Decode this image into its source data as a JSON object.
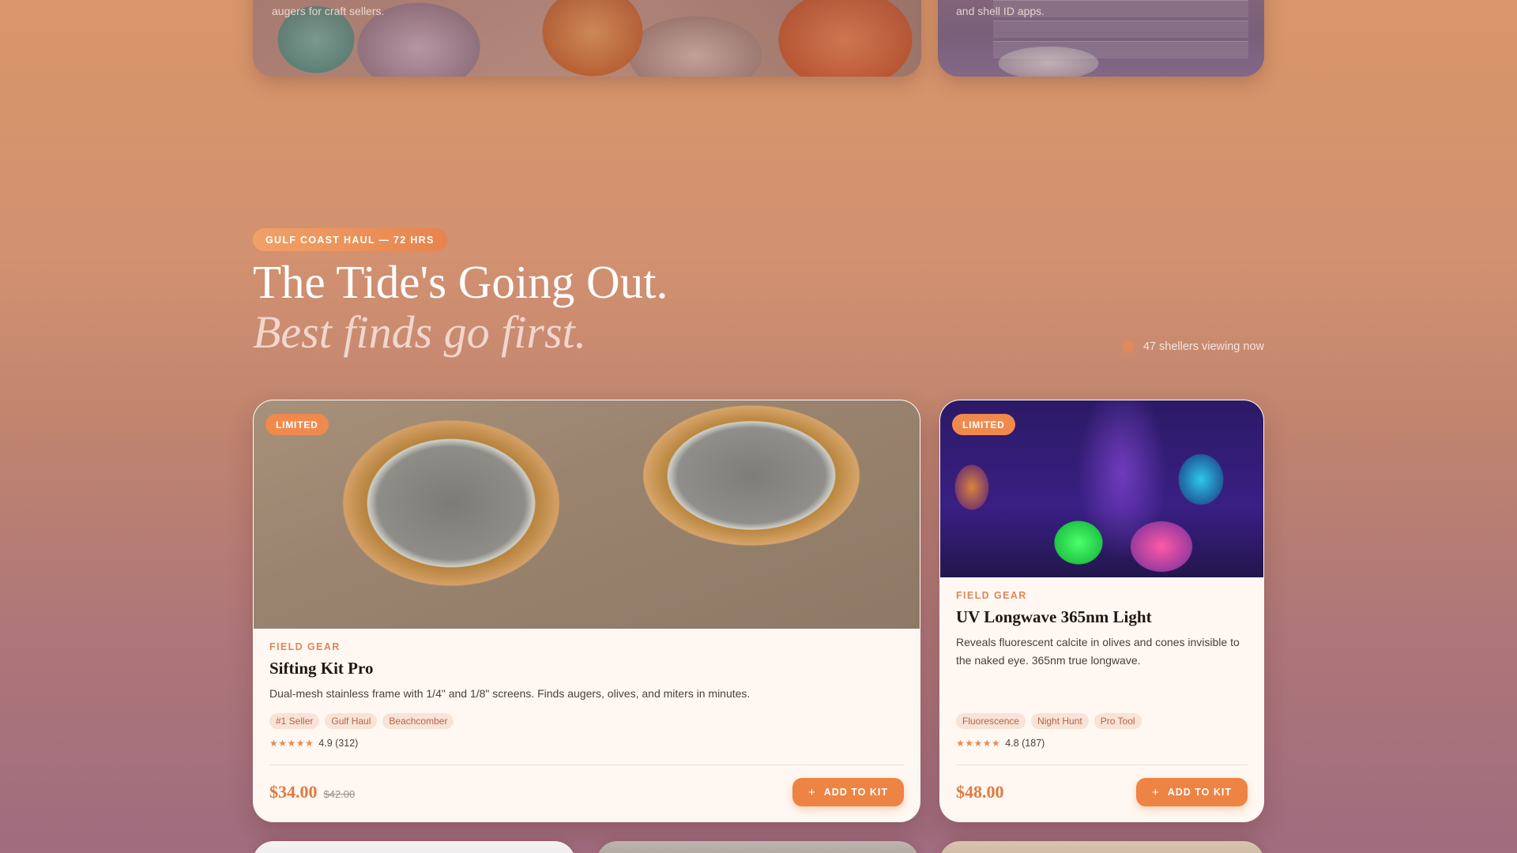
{
  "top_cards": [
    {
      "caption": "augers for craft sellers."
    },
    {
      "caption": "and shell ID apps."
    }
  ],
  "section": {
    "pill": "GULF COAST HAUL — 72 HRS",
    "headline": "The Tide's Going Out.",
    "subline": "Best finds go first.",
    "viewing": "47 shellers viewing now"
  },
  "products": [
    {
      "badge": "LIMITED",
      "kicker": "FIELD GEAR",
      "title": "Sifting Kit Pro",
      "desc": "Dual-mesh stainless frame with 1/4\" and 1/8\" screens. Finds augers, olives, and miters in minutes.",
      "tags": [
        "#1 Seller",
        "Gulf Haul",
        "Beachcomber"
      ],
      "stars": "★★★★★",
      "rating": "4.9 (312)",
      "price": "$34.00",
      "was": "$42.00",
      "cta": "ADD TO KIT"
    },
    {
      "badge": "LIMITED",
      "kicker": "FIELD GEAR",
      "title": "UV Longwave 365nm Light",
      "desc": "Reveals fluorescent calcite in olives and cones invisible to the naked eye. 365nm true longwave.",
      "tags": [
        "Fluorescence",
        "Night Hunt",
        "Pro Tool"
      ],
      "stars": "★★★★★",
      "rating": "4.8 (187)",
      "price": "$48.00",
      "cta": "ADD TO KIT"
    }
  ],
  "icons": {
    "plus": "+",
    "live_dot": "live-dot"
  }
}
